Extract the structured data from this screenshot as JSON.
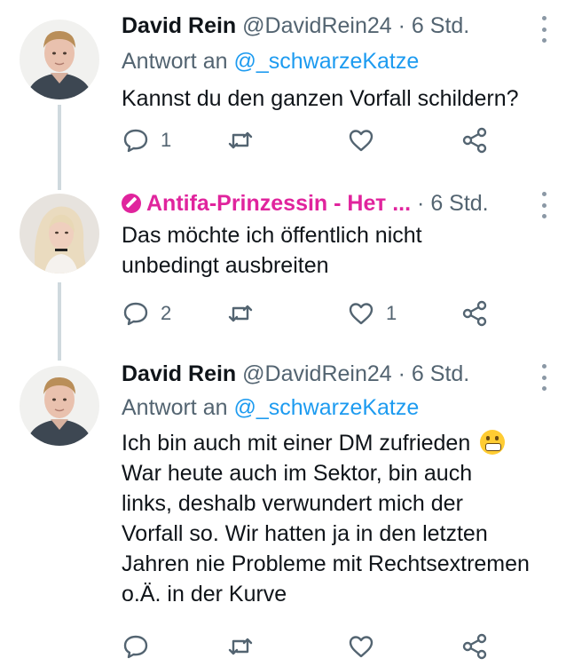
{
  "tweets": [
    {
      "name": "David Rein",
      "handle": "@DavidRein24",
      "separator": "·",
      "time": "6 Std.",
      "reply_prefix": "Antwort an",
      "reply_to": "@_schwarzeKatze",
      "text": "Kannst du den ganzen Vorfall schildern?",
      "replies": "1",
      "retweets": "",
      "likes": ""
    },
    {
      "name": "Antifa-Prinzessin - Нет ...",
      "separator": "·",
      "time": "6 Std.",
      "text_lines": [
        "Das möchte ich öffentlich nicht",
        "unbedingt ausbreiten"
      ],
      "replies": "2",
      "retweets": "",
      "likes": "1"
    },
    {
      "name": "David Rein",
      "handle": "@DavidRein24",
      "separator": "·",
      "time": "6 Std.",
      "reply_prefix": "Antwort an",
      "reply_to": "@_schwarzeKatze",
      "text_lines": [
        "Ich bin auch mit einer DM zufrieden",
        "War heute auch im Sektor, bin auch",
        "links, deshalb verwundert mich der",
        "Vorfall so. Wir hatten ja in den letzten",
        "Jahren nie Probleme mit Rechtsextremen",
        "o.Ä. in der Kurve"
      ],
      "replies": "",
      "retweets": "",
      "likes": ""
    }
  ],
  "icons": {
    "reply": "reply-icon",
    "retweet": "retweet-icon",
    "like": "heart-icon",
    "share": "share-icon",
    "more": "more-icon",
    "emoji": "grimacing-face-emoji"
  },
  "colors": {
    "text": "#0f1419",
    "secondary": "#536471",
    "link": "#1d9bf0",
    "accent_name": "#e0249d",
    "thread_line": "#cfd9de"
  }
}
